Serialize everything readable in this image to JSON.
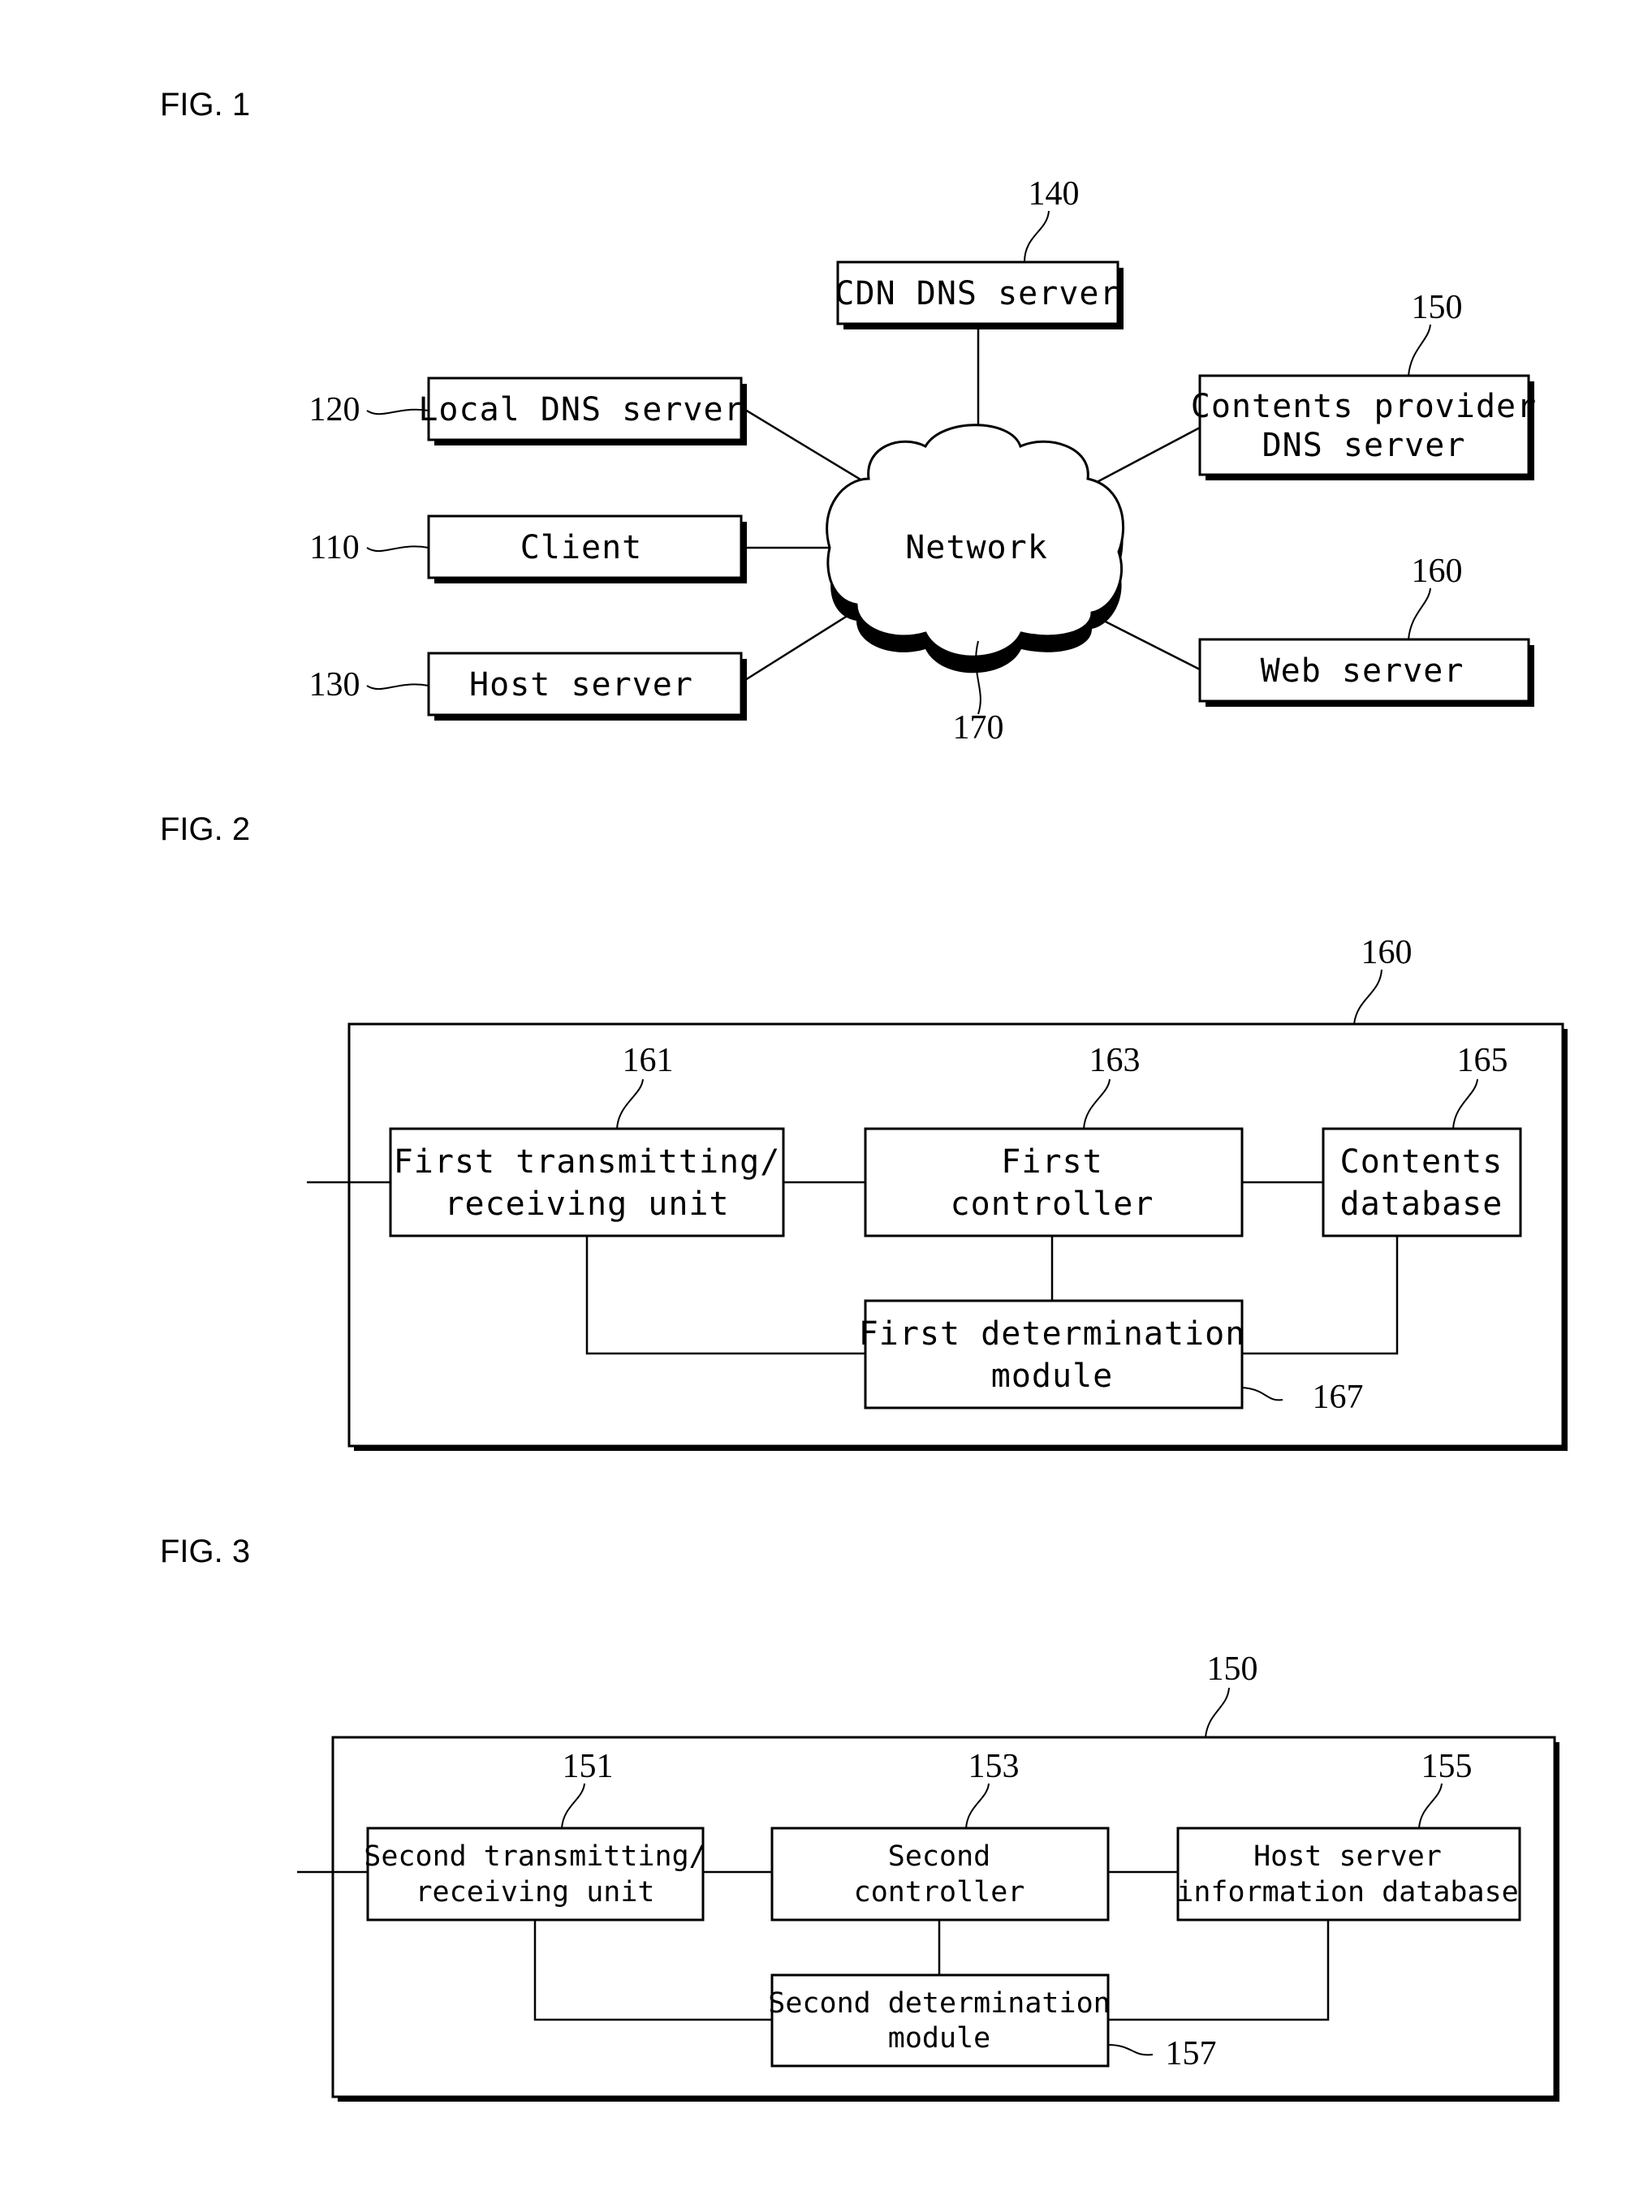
{
  "fig1": {
    "title": "FIG. 1",
    "network": {
      "label": "Network",
      "ref": "170"
    },
    "nodes": {
      "cdn_dns": {
        "label": "CDN DNS server",
        "ref": "140"
      },
      "local_dns": {
        "label": "Local DNS server",
        "ref": "120"
      },
      "client": {
        "label": "Client",
        "ref": "110"
      },
      "host_server": {
        "label": "Host server",
        "ref": "130"
      },
      "contents_provider_dns": {
        "label_line1": "Contents provider",
        "label_line2": "DNS server",
        "ref": "150"
      },
      "web_server": {
        "label": "Web server",
        "ref": "160"
      }
    }
  },
  "fig2": {
    "title": "FIG. 2",
    "container_ref": "160",
    "blocks": {
      "transceiver": {
        "line1": "First transmitting/",
        "line2": "receiving unit",
        "ref": "161"
      },
      "controller": {
        "line1": "First",
        "line2": "controller",
        "ref": "163"
      },
      "database": {
        "line1": "Contents",
        "line2": "database",
        "ref": "165"
      },
      "determination": {
        "line1": "First determination",
        "line2": "module",
        "ref": "167"
      }
    }
  },
  "fig3": {
    "title": "FIG. 3",
    "container_ref": "150",
    "blocks": {
      "transceiver": {
        "line1": "Second transmitting/",
        "line2": "receiving unit",
        "ref": "151"
      },
      "controller": {
        "line1": "Second",
        "line2": "controller",
        "ref": "153"
      },
      "database": {
        "line1": "Host server",
        "line2": "information database",
        "ref": "155"
      },
      "determination": {
        "line1": "Second determination",
        "line2": "module",
        "ref": "157"
      }
    }
  }
}
